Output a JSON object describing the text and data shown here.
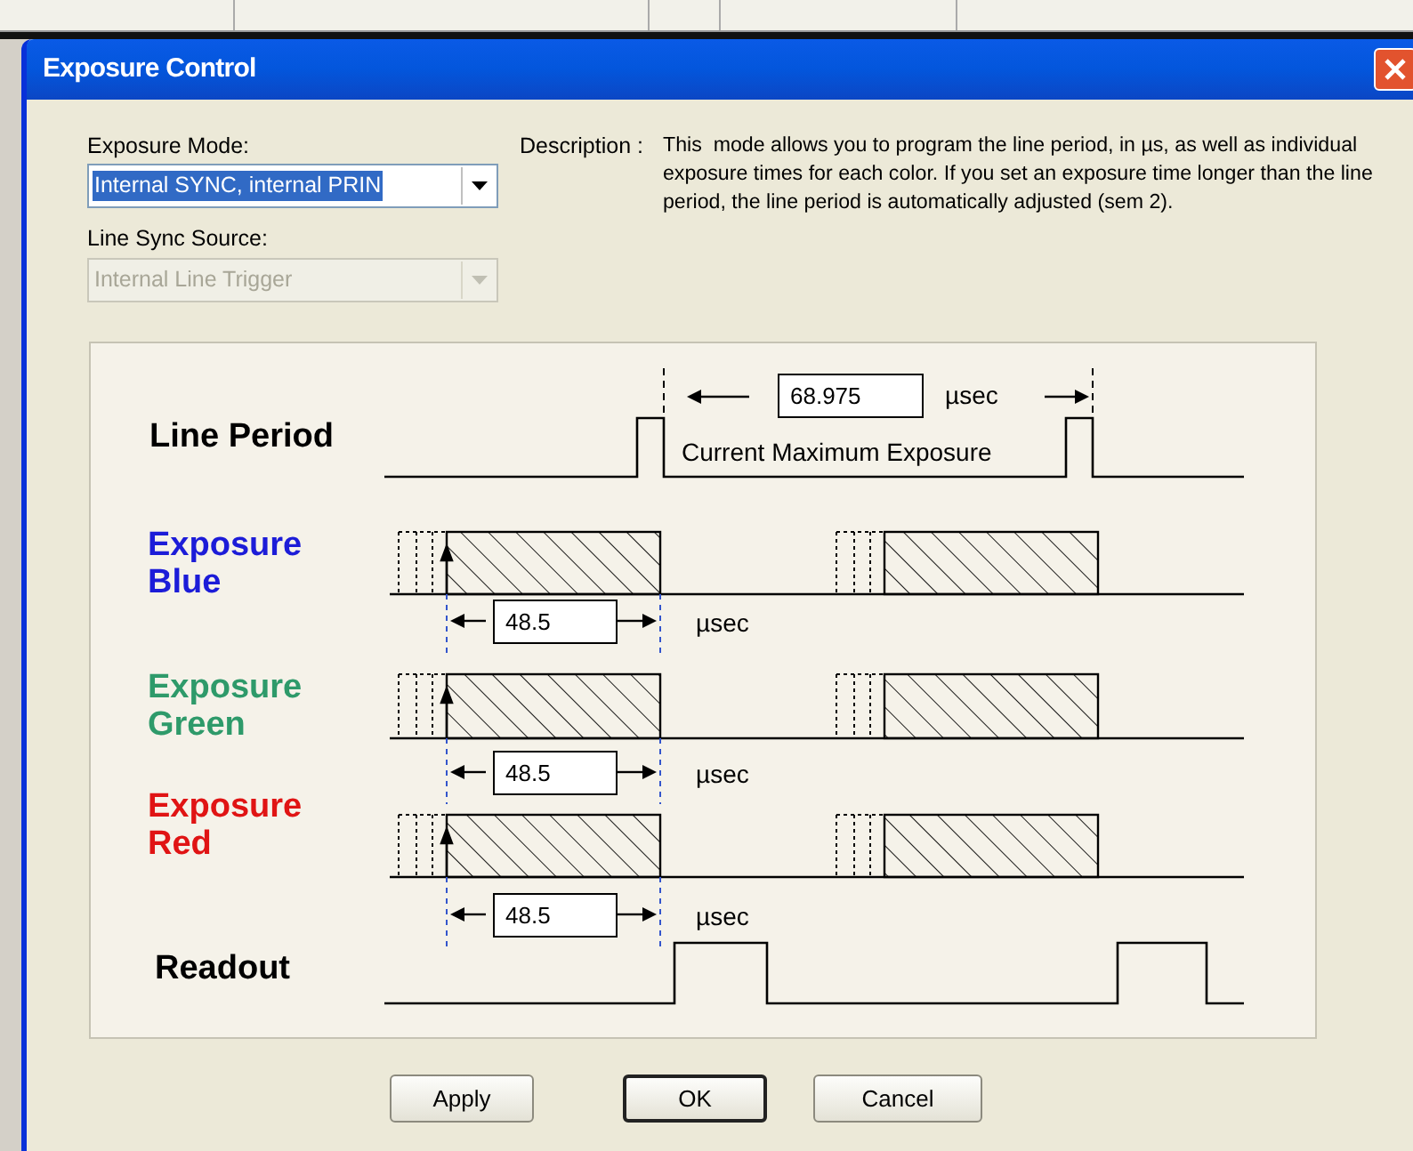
{
  "window": {
    "title": "Exposure Control"
  },
  "exposure_mode": {
    "label": "Exposure Mode:",
    "value": "Internal SYNC, internal PRIN",
    "disabled": false
  },
  "line_sync_source": {
    "label": "Line Sync Source:",
    "value": "Internal Line Trigger",
    "disabled": true
  },
  "description": {
    "label": "Description :",
    "text": "This  mode allows you to program the line period, in µs, as well as individual exposure times for each color. If you set an exposure time longer than the line period, the line period is automatically adjusted (sem 2)."
  },
  "line_period": {
    "label": "Line Period",
    "value": "68.975",
    "unit": "µsec",
    "caption": "Current Maximum Exposure"
  },
  "exposures": [
    {
      "label": "Exposure Blue",
      "color": "#1c1cd8",
      "value": "48.5",
      "unit": "µsec"
    },
    {
      "label": "Exposure Green",
      "color": "#2e9a6a",
      "value": "48.5",
      "unit": "µsec"
    },
    {
      "label": "Exposure Red",
      "color": "#e01414",
      "value": "48.5",
      "unit": "µsec"
    }
  ],
  "readout": {
    "label": "Readout"
  },
  "buttons": [
    {
      "label": "Apply",
      "default": false
    },
    {
      "label": "OK",
      "default": true
    },
    {
      "label": "Cancel",
      "default": false
    }
  ]
}
